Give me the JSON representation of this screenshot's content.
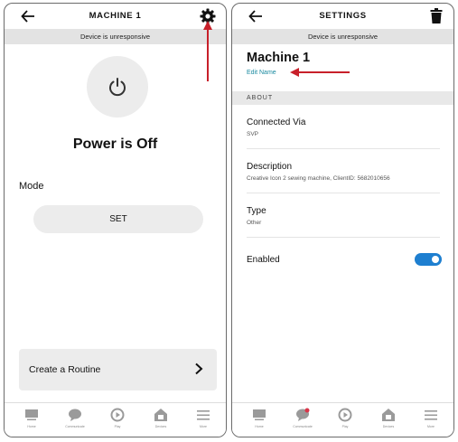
{
  "left_screen": {
    "title": "MACHINE 1",
    "banner": "Device is unresponsive",
    "power_status": "Power is Off",
    "mode_label": "Mode",
    "set_button": "SET",
    "routine_label": "Create a Routine",
    "nav": [
      "Home",
      "Communicate",
      "Play",
      "Devices",
      "More"
    ]
  },
  "right_screen": {
    "title": "SETTINGS",
    "banner": "Device is unresponsive",
    "device_name": "Machine 1",
    "edit_name": "Edit Name",
    "section": "ABOUT",
    "connected_via": {
      "label": "Connected Via",
      "value": "SVP"
    },
    "description": {
      "label": "Description",
      "value": "Creative Icon 2 sewing machine, ClientID: 5682010656"
    },
    "type": {
      "label": "Type",
      "value": "Other"
    },
    "enabled": {
      "label": "Enabled",
      "value": true
    },
    "nav": [
      "Home",
      "Communicate",
      "Play",
      "Devices",
      "More"
    ]
  },
  "colors": {
    "accent": "#1e7fd0",
    "link": "#1a8aa0",
    "annotation_arrow": "#c8202a"
  }
}
